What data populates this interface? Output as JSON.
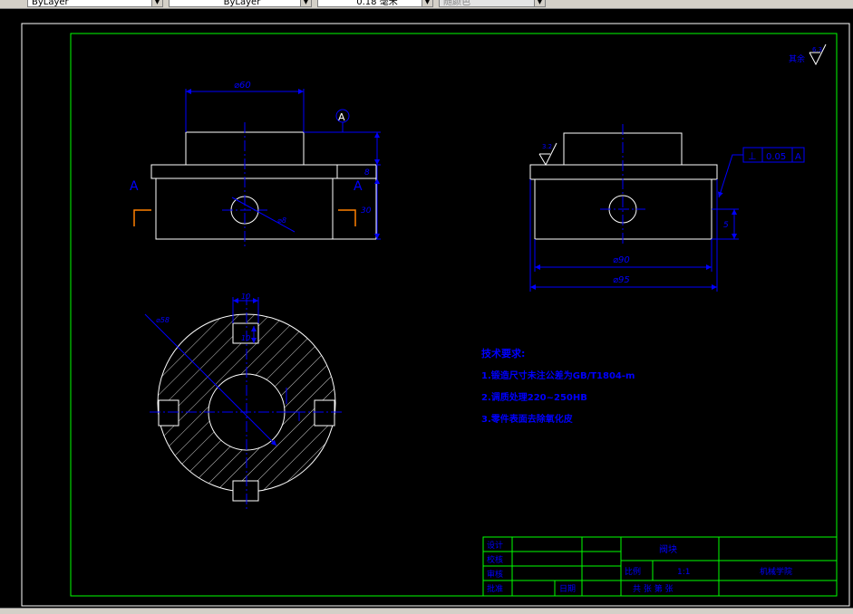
{
  "toolbar": {
    "linetype_value": "ByLayer",
    "lineweight_value": "ByLayer",
    "thickness_value": "0.18 毫米",
    "color_value": "随颜色"
  },
  "drawing": {
    "roughness_other": "其余",
    "roughness_other_value": "6.3",
    "roughness_face_value": "3.2",
    "dim_phi60": "⌀60",
    "dim_phi90": "⌀90",
    "dim_phi95": "⌀95",
    "dim_8": "8",
    "dim_30": "30",
    "dim_5": "5",
    "dim_r_hole": "⌀8",
    "dim_key_w": "10",
    "dim_key_h": "10",
    "dim_section_dia": "⌀58",
    "section_label_a": "A",
    "tolerance_symbol": "⊥",
    "tolerance_value": "0.05",
    "tolerance_datum": "A",
    "tech_title": "技术要求:",
    "tech_1": "1.锻造尺寸未注公差为GB/T1804-m",
    "tech_2": "2.调质处理220~250HB",
    "tech_3": "3.零件表面去除氧化皮"
  },
  "title_block": {
    "design": "设计",
    "check": "校核",
    "review": "审核",
    "approve": "批准",
    "date": "日期",
    "part_name": "阀块",
    "scale_label": "比例",
    "scale_value": "1:1",
    "quantity": "共  张  第  张",
    "school": "机械学院"
  },
  "colors": {
    "frame": "#00ff00",
    "geometry": "#0000ff",
    "centerline": "#0000ff",
    "dimension": "#0000ff",
    "text": "#0000ff",
    "white": "#ffffff",
    "arrow": "#ff8000"
  }
}
